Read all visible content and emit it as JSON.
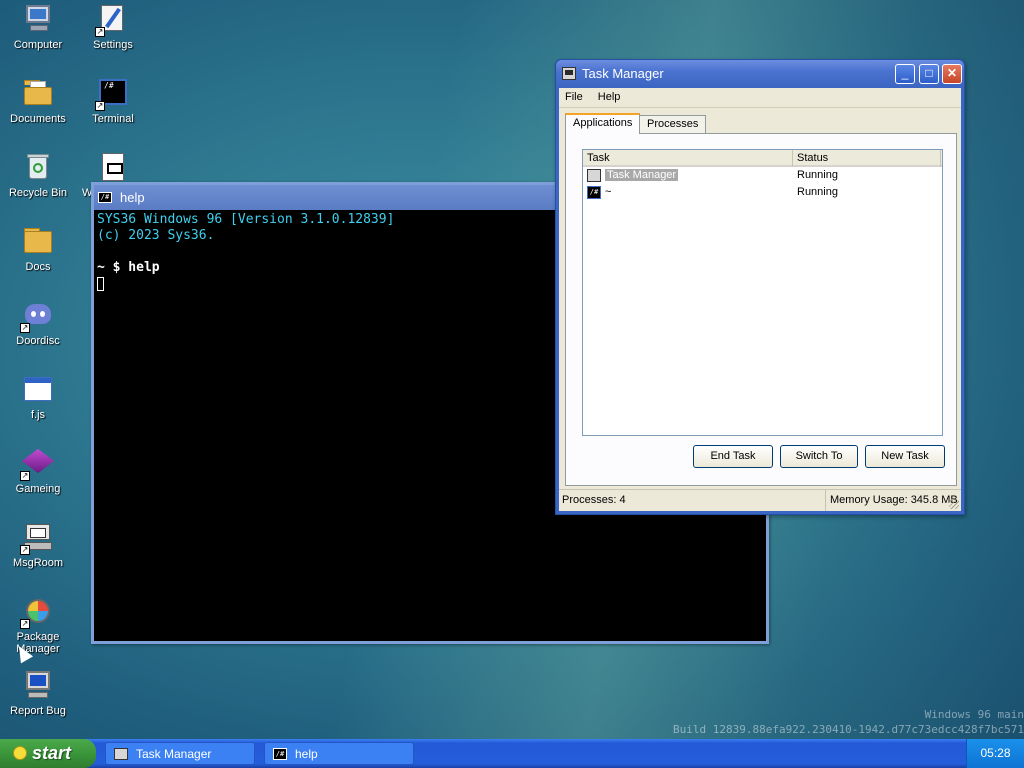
{
  "desktop": {
    "icons": [
      {
        "label": "Computer",
        "icon": "computer-icon"
      },
      {
        "label": "Settings",
        "icon": "settings-icon"
      },
      {
        "label": "Documents",
        "icon": "documents-folder-icon"
      },
      {
        "label": "Terminal",
        "icon": "terminal-icon"
      },
      {
        "label": "Recycle Bin",
        "icon": "recycle-bin-icon"
      },
      {
        "label": "W",
        "icon": "file-icon"
      },
      {
        "label": "Docs",
        "icon": "folder-icon"
      },
      {
        "label": "Doordisc",
        "icon": "discord-icon"
      },
      {
        "label": "f.js",
        "icon": "window-file-icon"
      },
      {
        "label": "Gameing",
        "icon": "game-cube-icon"
      },
      {
        "label": "MsgRoom",
        "icon": "msgroom-icon"
      },
      {
        "label": "Package Manager",
        "icon": "package-manager-icon"
      },
      {
        "label": "Report Bug",
        "icon": "report-bug-icon"
      }
    ],
    "watermark_line1": "Windows 96 main",
    "watermark_line2": "Build 12839.88efa922.230410-1942.d77c73edcc428f7bc571"
  },
  "terminal": {
    "title": "help",
    "icon_text": "/#",
    "lines": [
      "SYS36 Windows 96 [Version 3.1.0.12839]",
      "(c) 2023 Sys36.",
      "",
      "~ $ help"
    ]
  },
  "task_manager": {
    "title": "Task Manager",
    "menu": [
      "File",
      "Help"
    ],
    "tabs": [
      "Applications",
      "Processes"
    ],
    "active_tab": "Applications",
    "columns": [
      "Task",
      "Status"
    ],
    "rows": [
      {
        "task": "Task Manager",
        "status": "Running",
        "icon": "task-manager-icon"
      },
      {
        "task": "~",
        "status": "Running",
        "icon": "terminal-icon"
      }
    ],
    "buttons": {
      "end_task": "End Task",
      "switch_to": "Switch To",
      "new_task": "New Task"
    },
    "status_processes": "Processes: 4",
    "status_memory": "Memory Usage: 345.8 MB",
    "window_buttons": {
      "minimize": "_",
      "maximize": "□",
      "close": "✕"
    }
  },
  "taskbar": {
    "start_label": "start",
    "items": [
      {
        "label": "Task Manager",
        "icon": "task-manager-icon"
      },
      {
        "label": "help",
        "icon": "terminal-icon"
      }
    ],
    "clock": "05:28"
  }
}
